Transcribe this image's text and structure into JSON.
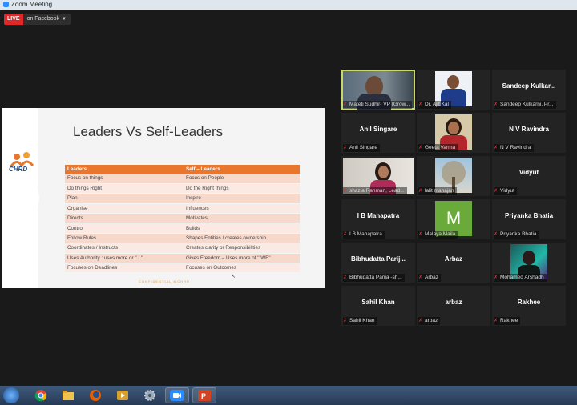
{
  "window": {
    "title": "Zoom Meeting"
  },
  "live": {
    "badge": "LIVE",
    "destination": "on Facebook",
    "caret": "▼"
  },
  "slide": {
    "title": "Leaders Vs Self-Leaders",
    "logo_text": "CHRD",
    "headers": [
      "Leaders",
      "Self – Leaders"
    ],
    "rows": [
      [
        "Focus on things",
        "Focus on People"
      ],
      [
        "Do things Right",
        "Do the Right things"
      ],
      [
        "Plan",
        "Inspire"
      ],
      [
        "Organise",
        "Influences"
      ],
      [
        "Directs",
        "Motivates"
      ],
      [
        "Control",
        "Builds"
      ],
      [
        "Follow Rules",
        "Shapes Entities / creates ownership"
      ],
      [
        "Coordinates / Instructs",
        "Creates clarity or Responsibilities"
      ],
      [
        "Uses Authority : uses more or \" I \"",
        "Gives Freedom – Uses more of \" WE\""
      ],
      [
        "Focuses on Deadlines",
        "Focuses on Outcomes"
      ]
    ],
    "footer": "CONFIDENTIAL @CHRD"
  },
  "participants": [
    {
      "label": "Mateti Sudhir- VP (Grow...",
      "big": "",
      "video": "man-glasses",
      "active": true
    },
    {
      "label": "Dr. Ajit Kal",
      "big": "",
      "video": "man-suit"
    },
    {
      "label": "Sandeep Kulkarni, Pr...",
      "big": "Sandeep  Kulkar..."
    },
    {
      "label": "Anil Singare",
      "big": "Anil Singare"
    },
    {
      "label": "Geeta Varma",
      "big": "",
      "video": "woman-red"
    },
    {
      "label": "N V Ravindra",
      "big": "N V Ravindra"
    },
    {
      "label": "shazia Rahman, Lead...",
      "big": "",
      "video": "woman-room"
    },
    {
      "label": "lalit mahajan",
      "big": "",
      "video": "tree"
    },
    {
      "label": "Vidyut",
      "big": "Vidyut"
    },
    {
      "label": "I B Mahapatra",
      "big": "I B Mahapatra"
    },
    {
      "label": "Malaya Maila",
      "big": "",
      "avatar": "M"
    },
    {
      "label": "Priyanka Bhatia",
      "big": "Priyanka Bhatia"
    },
    {
      "label": "Bibhudatta Parija -sh...",
      "big": "Bibhudatta   Parij..."
    },
    {
      "label": "Arbaz",
      "big": "Arbaz"
    },
    {
      "label": "Mohamed Arshadh",
      "big": "",
      "video": "man-neon"
    },
    {
      "label": "Sahil Khan",
      "big": "Sahil Khan"
    },
    {
      "label": "arbaz",
      "big": "arbaz"
    },
    {
      "label": "Rakhee",
      "big": "Rakhee"
    }
  ],
  "taskbar": [
    "start-orb",
    "chrome-icon",
    "file-explorer-icon",
    "firefox-icon",
    "media-player-icon",
    "settings-icon",
    "zoom-icon",
    "powerpoint-icon"
  ]
}
